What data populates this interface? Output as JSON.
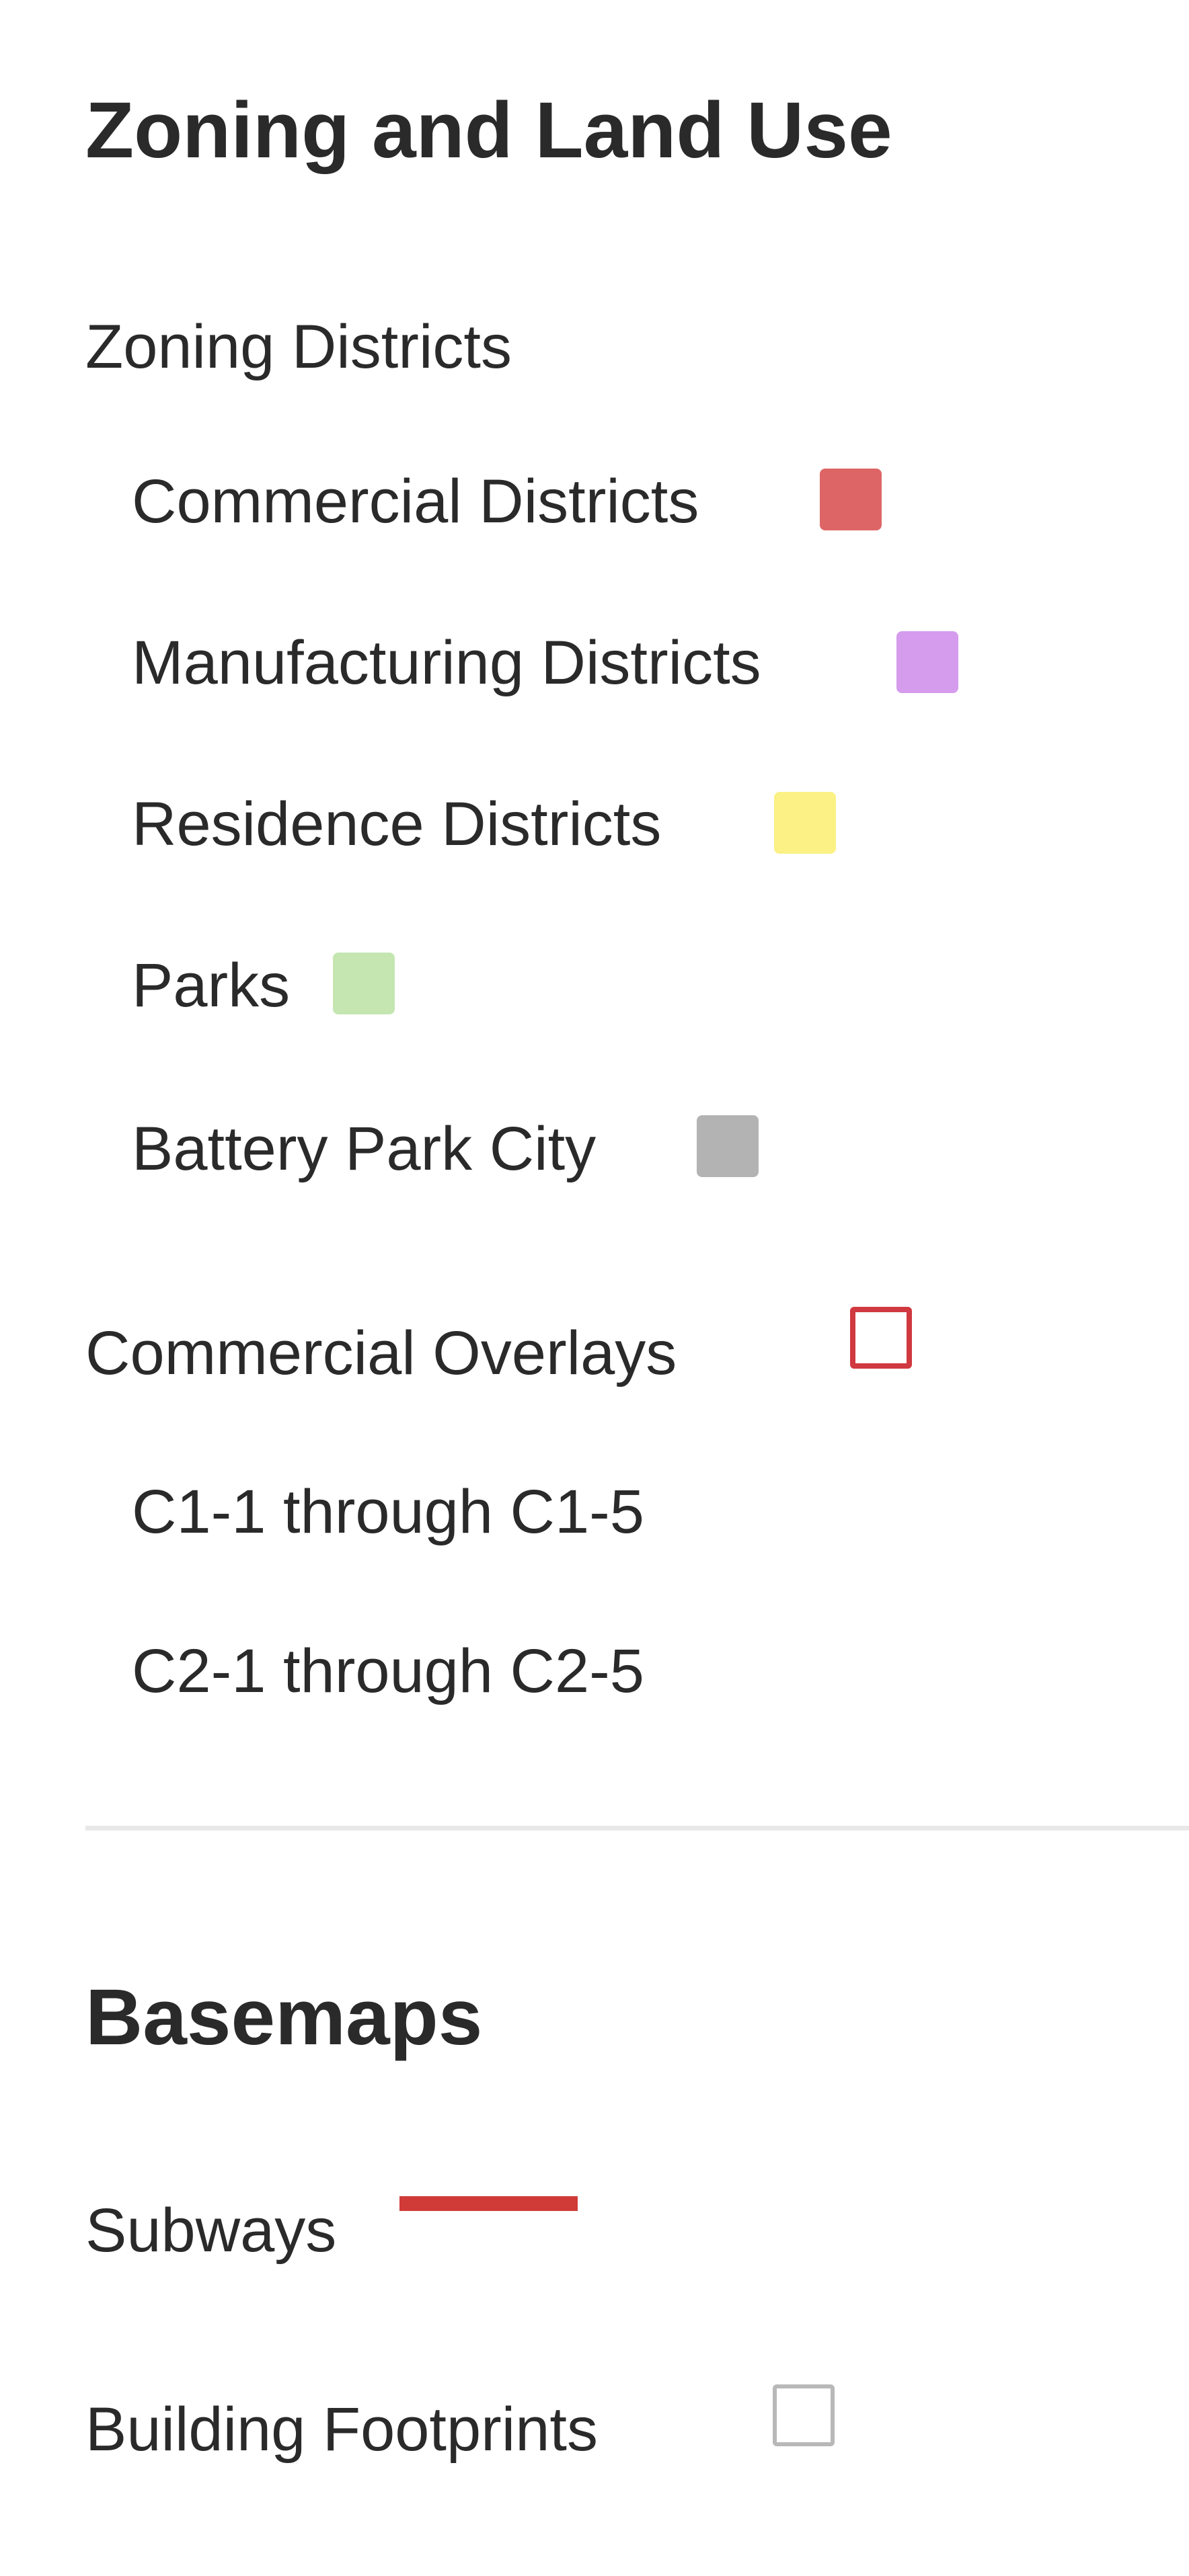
{
  "legend": {
    "title": "Zoning and Land Use",
    "zoning_districts": {
      "label": "Zoning Districts",
      "items": [
        {
          "label": "Commercial Districts",
          "color": "#de6566"
        },
        {
          "label": "Manufacturing Districts",
          "color": "#d59ced"
        },
        {
          "label": "Residence Districts",
          "color": "#fbf185"
        },
        {
          "label": "Parks",
          "color": "#c5e6b1"
        },
        {
          "label": "Battery Park City",
          "color": "#b3b3b3"
        }
      ]
    },
    "commercial_overlays": {
      "label": "Commercial Overlays",
      "outline_color": "#d0393f",
      "items": [
        {
          "label": "C1-1 through C1-5"
        },
        {
          "label": "C2-1 through C2-5"
        }
      ]
    }
  },
  "basemaps": {
    "title": "Basemaps",
    "items": [
      {
        "label": "Subways",
        "swatch": "line",
        "color": "#d03a37"
      },
      {
        "label": "Building Footprints",
        "swatch": "outline-box",
        "color": "#b8b8b8"
      }
    ]
  }
}
